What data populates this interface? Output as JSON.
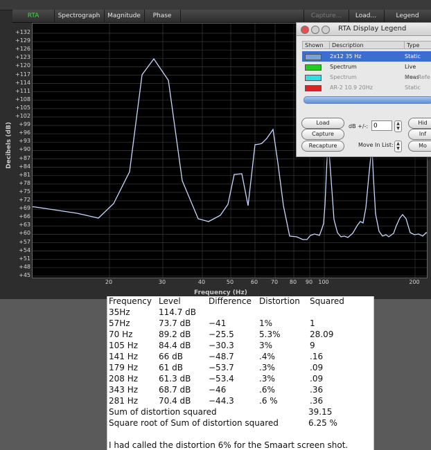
{
  "tabs": [
    "RTA",
    "Spectrograph",
    "Magnitude",
    "Phase",
    "Capture...",
    "Load...",
    "Legend"
  ],
  "plot": {
    "ylabel": "Decibels (dB)",
    "xlabel": "Frequency (Hz)",
    "yticks": [
      "+132",
      "+129",
      "+126",
      "+123",
      "+120",
      "+117",
      "+114",
      "+111",
      "+108",
      "+105",
      "+102",
      "+99",
      "+96",
      "+93",
      "+90",
      "+87",
      "+84",
      "+81",
      "+78",
      "+75",
      "+72",
      "+69",
      "+66",
      "+63",
      "+60",
      "+57",
      "+54",
      "+51",
      "+48",
      "+45"
    ],
    "xticks": [
      "20",
      "30",
      "40",
      "50",
      "60",
      "70",
      "80",
      "90",
      "100",
      "200"
    ],
    "trace_color": "#c8d8ff"
  },
  "legend": {
    "title": "RTA Display Legend",
    "headers": [
      "Shown",
      "Description",
      "Type"
    ],
    "rows": [
      {
        "desc": "2x12 35 Hz",
        "type": "Static",
        "color": "#7f9fd8",
        "selected": true
      },
      {
        "desc": "Spectrum",
        "type": "Live Meas",
        "color": "#22cc22",
        "selected": false
      },
      {
        "desc": "Spectrum",
        "type": "Live Refe",
        "color": "#33dddd",
        "selected": false,
        "dim": true
      },
      {
        "desc": "AR-2 10.9 20Hz",
        "type": "Static",
        "color": "#dd2222",
        "selected": false,
        "dim": true
      }
    ],
    "buttons": {
      "load": "Load",
      "capture": "Capture",
      "recapture": "Recapture",
      "hide": "Hid",
      "info": "Inf",
      "more": "Mo"
    },
    "db_label": "dB +/-:",
    "db_value": "0",
    "move_label": "Move In List:"
  },
  "table": {
    "header": [
      "Frequency",
      "Level",
      "Difference",
      "Distortion",
      "Squared"
    ],
    "rows": [
      [
        "35Hz",
        "114.7 dB",
        "",
        "",
        ""
      ],
      [
        "57Hz",
        "73.7 dB",
        "−41",
        "1%",
        "1"
      ],
      [
        "70 Hz",
        "89.2 dB",
        "−25.5",
        "5.3%",
        "28.09"
      ],
      [
        "105 Hz",
        "84.4 dB",
        "−30.3",
        "3%",
        "9"
      ],
      [
        "141 Hz",
        "66 dB",
        "−48.7",
        ".4%",
        ".16"
      ],
      [
        "179 Hz",
        "61 dB",
        "−53.7",
        ".3%",
        ".09"
      ],
      [
        "208 Hz",
        "61.3 dB",
        "−53.4",
        ".3%",
        ".09"
      ],
      [
        "343 Hz",
        "68.7 dB",
        "−46",
        ".6%",
        ".36"
      ],
      [
        "281 Hz",
        "70.4 dB",
        "−44.3",
        ".6 %",
        ".36"
      ]
    ],
    "sum_label": "Sum of distortion squared",
    "sum_value": "39.15",
    "sqrt_label": "Square root of Sum of distortion squared",
    "sqrt_value": "6.25 %",
    "note": "I had called the distortion 6% for the  Smaart screen shot."
  }
}
